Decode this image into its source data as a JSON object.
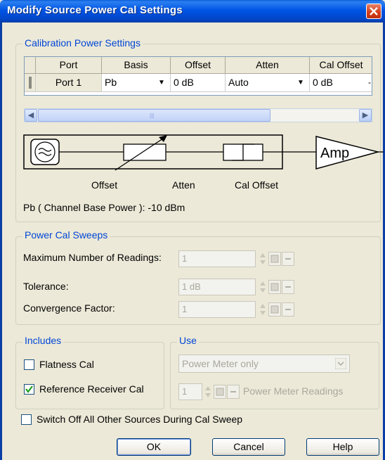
{
  "window": {
    "title": "Modify Source Power Cal Settings"
  },
  "calibration": {
    "legend": "Calibration Power Settings",
    "columns": [
      "Port",
      "Basis",
      "Offset",
      "Atten",
      "Cal Offset"
    ],
    "row": {
      "port": "Port 1",
      "basis": "Pb",
      "offset": "0 dB",
      "atten": "Auto",
      "cal_offset": "0 dB"
    },
    "diagram": {
      "offset_label": "Offset",
      "atten_label": "Atten",
      "cal_offset_label": "Cal Offset",
      "amp_label": "Amp"
    },
    "base_power_text": "Pb ( Channel Base Power ): -10 dBm"
  },
  "sweeps": {
    "legend": "Power Cal Sweeps",
    "max_readings_label": "Maximum Number of Readings:",
    "max_readings_value": "1",
    "tolerance_label": "Tolerance:",
    "tolerance_value": "1 dB",
    "convergence_label": "Convergence Factor:",
    "convergence_value": "1"
  },
  "includes": {
    "legend": "Includes",
    "flatness_label": "Flatness Cal",
    "flatness_checked": false,
    "reference_label": "Reference Receiver Cal",
    "reference_checked": true
  },
  "use": {
    "legend": "Use",
    "selected": "Power Meter only",
    "readings_value": "1",
    "readings_label": "Power Meter Readings"
  },
  "switch_off": {
    "label": "Switch Off All Other Sources During Cal Sweep",
    "checked": false
  },
  "buttons": {
    "ok": "OK",
    "cancel": "Cancel",
    "help": "Help"
  },
  "colors": {
    "title_bar": "#0055e5",
    "group_legend": "#0046d5",
    "dialog_bg": "#ece9d8"
  }
}
